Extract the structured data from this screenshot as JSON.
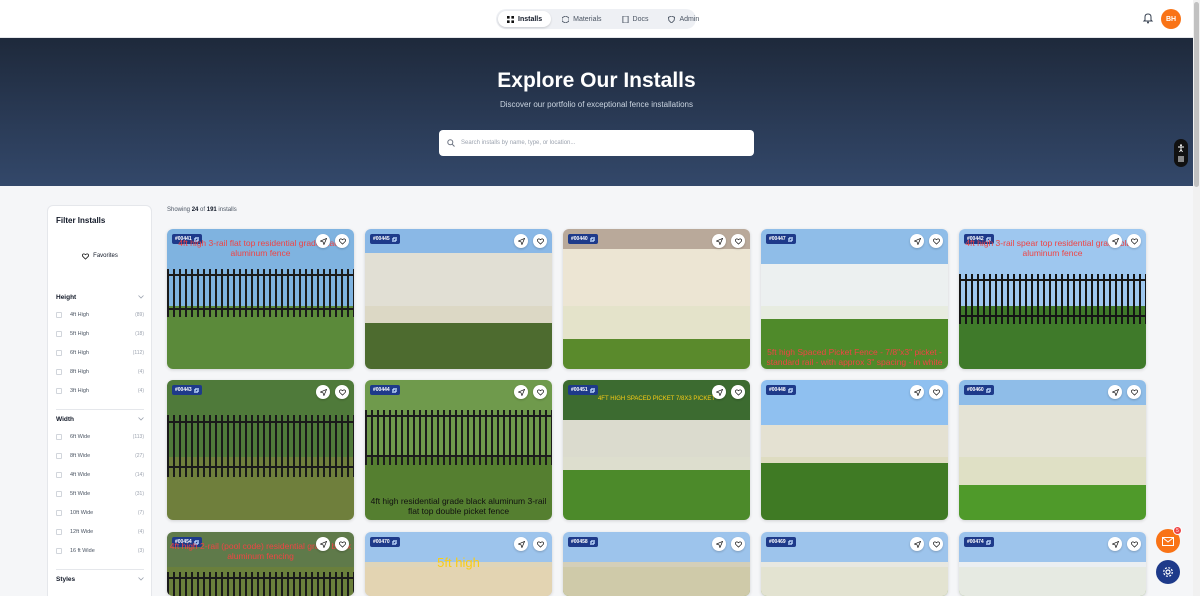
{
  "nav": {
    "tabs": [
      {
        "label": "Installs",
        "icon": "grid-icon",
        "active": true
      },
      {
        "label": "Materials",
        "icon": "box-icon",
        "active": false
      },
      {
        "label": "Docs",
        "icon": "document-icon",
        "active": false
      },
      {
        "label": "Admin",
        "icon": "shield-icon",
        "active": false
      }
    ],
    "avatar_initials": "BH"
  },
  "hero": {
    "title": "Explore Our Installs",
    "subtitle": "Discover our portfolio of exceptional fence installations",
    "search_placeholder": "Search installs by name, type, or location..."
  },
  "sidebar": {
    "title": "Filter Installs",
    "favorites_label": "Favorites",
    "sections": [
      {
        "title": "Height",
        "options": [
          {
            "label": "4ft High",
            "count": "(89)"
          },
          {
            "label": "5ft High",
            "count": "(18)"
          },
          {
            "label": "6ft High",
            "count": "(112)"
          },
          {
            "label": "8ft High",
            "count": "(4)"
          },
          {
            "label": "3ft High",
            "count": "(4)"
          }
        ]
      },
      {
        "title": "Width",
        "options": [
          {
            "label": "6ft Wide",
            "count": "(113)"
          },
          {
            "label": "8ft Wide",
            "count": "(27)"
          },
          {
            "label": "4ft Wide",
            "count": "(14)"
          },
          {
            "label": "5ft Wide",
            "count": "(31)"
          },
          {
            "label": "10ft Wide",
            "count": "(7)"
          },
          {
            "label": "12ft Wide",
            "count": "(4)"
          },
          {
            "label": "16 ft Wide",
            "count": "(3)"
          }
        ]
      },
      {
        "title": "Styles",
        "options": []
      }
    ]
  },
  "results": {
    "prefix": "Showing",
    "shown": "24",
    "of": "of",
    "total": "191",
    "suffix": "installs"
  },
  "cards": [
    {
      "id": "#00441",
      "overlay": "4ft high 3-rail flat top residential grade black aluminum fence"
    },
    {
      "id": "#00445",
      "overlay": ""
    },
    {
      "id": "#00440",
      "overlay": ""
    },
    {
      "id": "#00447",
      "overlay": "5ft high Spaced Picket Fence - 7/8\"x3\" picket - standard rail - with approx 3\" spacing - in white"
    },
    {
      "id": "#00442",
      "overlay": "4ft high 3-rail spear top residential grade black aluminum fence"
    },
    {
      "id": "#00443",
      "overlay": ""
    },
    {
      "id": "#00444",
      "overlay": "4ft high residential grade black aluminum 3-rail flat top double picket fence"
    },
    {
      "id": "#00451",
      "overlay": "4FT HIGH SPACED PICKET 7/8X3 PICKET"
    },
    {
      "id": "#00448",
      "overlay": ""
    },
    {
      "id": "#00460",
      "overlay": ""
    },
    {
      "id": "#00454",
      "overlay": "4ft high 2-rail (pool code) residential grade black aluminum fencing"
    },
    {
      "id": "#00470",
      "overlay": "5ft high"
    },
    {
      "id": "#00458",
      "overlay": ""
    },
    {
      "id": "#00469",
      "overlay": ""
    },
    {
      "id": "#00474",
      "overlay": ""
    }
  ],
  "fab": {
    "mail_badge": "5"
  },
  "colors": {
    "accent": "#f97316",
    "hero": "#1e293b",
    "tag": "#1e3a8a"
  }
}
